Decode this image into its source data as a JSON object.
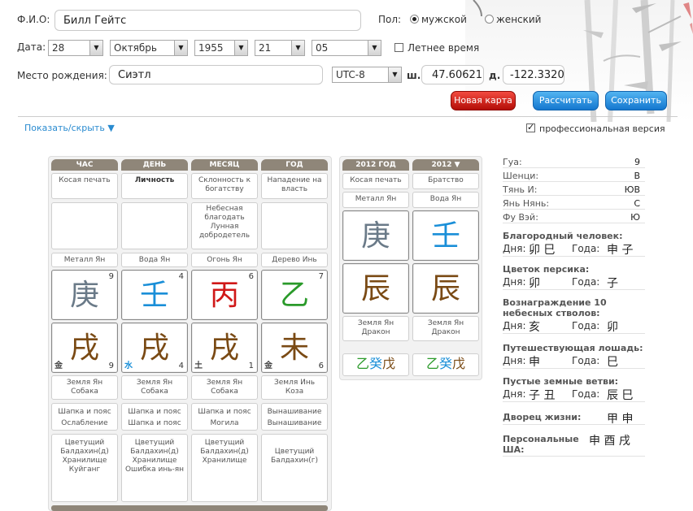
{
  "form": {
    "fio_label": "Ф.И.О:",
    "fio_value": "Билл Гейтс",
    "sex_label": "Пол:",
    "sex_male": "мужской",
    "sex_female": "женский",
    "date_label": "Дата:",
    "day": "28",
    "month": "Октябрь",
    "year": "1955",
    "hour": "21",
    "minute": "05",
    "dst_label": "Летнее время",
    "place_label": "Место рождения:",
    "place_value": "Сиэтл",
    "tz": "UTC-8",
    "lat_label": "ш.",
    "lat": "47.60621",
    "lon_label": "д.",
    "lon": "-122.3320"
  },
  "buttons": {
    "new_chart": "Новая карта",
    "calculate": "Рассчитать",
    "save": "Сохранить"
  },
  "toggle_link": "Показать/скрыть ▼",
  "pro_label": "профессиональная версия",
  "headers": [
    "ЧАС",
    "ДЕНЬ",
    "МЕСЯЦ",
    "ГОД"
  ],
  "year_headers": [
    "2012 ГОД",
    "2012 ▼"
  ],
  "stars": [
    "Косая печать",
    "Личность",
    "Склонность к богатству",
    "Нападение на власть"
  ],
  "stars2": [
    "",
    "",
    "Небесная благодать\nЛунная добродетель",
    ""
  ],
  "stem_names": [
    "Металл Ян",
    "Вода Ян",
    "Огонь Ян",
    "Дерево Инь"
  ],
  "stems": [
    {
      "glyph": "庚",
      "num": "9",
      "color": "#6a7a88"
    },
    {
      "glyph": "壬",
      "num": "4",
      "color": "#1a8fd8"
    },
    {
      "glyph": "丙",
      "num": "6",
      "color": "#d01818"
    },
    {
      "glyph": "乙",
      "num": "7",
      "color": "#2a9a2a"
    }
  ],
  "branches": [
    {
      "glyph": "戌",
      "num": "9",
      "el": "金",
      "el_color": "#444"
    },
    {
      "glyph": "戌",
      "num": "4",
      "el": "水",
      "el_color": "#1a8fd8"
    },
    {
      "glyph": "戌",
      "num": "1",
      "el": "土",
      "el_color": "#444"
    },
    {
      "glyph": "未",
      "num": "6",
      "el": "金",
      "el_color": "#444"
    }
  ],
  "branch_color": "#7a4a14",
  "branch_names": [
    "Земля Ян\nСобака",
    "Земля Ян\nСобака",
    "Земля Ян\nСобака",
    "Земля Инь\nКоза"
  ],
  "stages": [
    "Шапка и пояс\nОслабление",
    "Шапка и пояс\nШапка и пояс",
    "Шапка и пояс\nМогила",
    "Вынашивание\nВынашивание"
  ],
  "symbolic": [
    "Цветущий Балдахин(д)\nХранилище\nКуйганг",
    "Цветущий Балдахин(д)\nХранилище\nОшибка инь-ян",
    "Цветущий Балдахин(д)\nХранилище",
    "\nЦветущий Балдахин(г)"
  ],
  "year_stars": [
    "Косая печать",
    "Братство"
  ],
  "year_stem_names": [
    "Металл Ян",
    "Вода Ян"
  ],
  "year_stems": [
    {
      "glyph": "庚",
      "color": "#6a7a88"
    },
    {
      "glyph": "壬",
      "color": "#1a8fd8"
    }
  ],
  "year_branches": [
    {
      "glyph": "辰",
      "color": "#7a4a14"
    },
    {
      "glyph": "辰",
      "color": "#7a4a14"
    }
  ],
  "year_branch_names": [
    "Земля Ян\nДракон",
    "Земля Ян\nДракон"
  ],
  "hidden_stems": [
    [
      {
        "g": "乙",
        "c": "#2a9a2a"
      },
      {
        "g": "癸",
        "c": "#1a8fd8"
      },
      {
        "g": "戊",
        "c": "#7a4a14"
      }
    ],
    [
      {
        "g": "乙",
        "c": "#2a9a2a"
      },
      {
        "g": "癸",
        "c": "#1a8fd8"
      },
      {
        "g": "戊",
        "c": "#7a4a14"
      }
    ]
  ],
  "info": [
    {
      "k": "Гуа:",
      "v": "9"
    },
    {
      "k": "Шенци:",
      "v": "В"
    },
    {
      "k": "Тянь И:",
      "v": "ЮВ"
    },
    {
      "k": "Янь Нянь:",
      "v": "С"
    },
    {
      "k": "Фу Вэй:",
      "v": "Ю"
    }
  ],
  "sections": {
    "noble": {
      "title": "Благородный человек:",
      "day_label": "Дня:",
      "day": "卯 巳",
      "year_label": "Года:",
      "year": "申 子"
    },
    "peach": {
      "title": "Цветок персика:",
      "day_label": "Дня:",
      "day": "卯",
      "year_label": "Года:",
      "year": "子"
    },
    "reward": {
      "title": "Вознаграждение 10 небесных стволов:",
      "day_label": "Дня:",
      "day": "亥",
      "year_label": "Года:",
      "year": "卯"
    },
    "horse": {
      "title": "Путешествующая лошадь:",
      "day_label": "Дня:",
      "day": "申",
      "year_label": "Года:",
      "year": "巳"
    },
    "void": {
      "title": "Пустые земные ветви:",
      "day_label": "Дня:",
      "day": "子 丑",
      "year_label": "Года:",
      "year": "辰 巳"
    },
    "palace": {
      "title": "Дворец жизни:",
      "value": "甲 申"
    },
    "sha": {
      "title": "Персональные ША:",
      "value": "申 酉 戌"
    }
  }
}
